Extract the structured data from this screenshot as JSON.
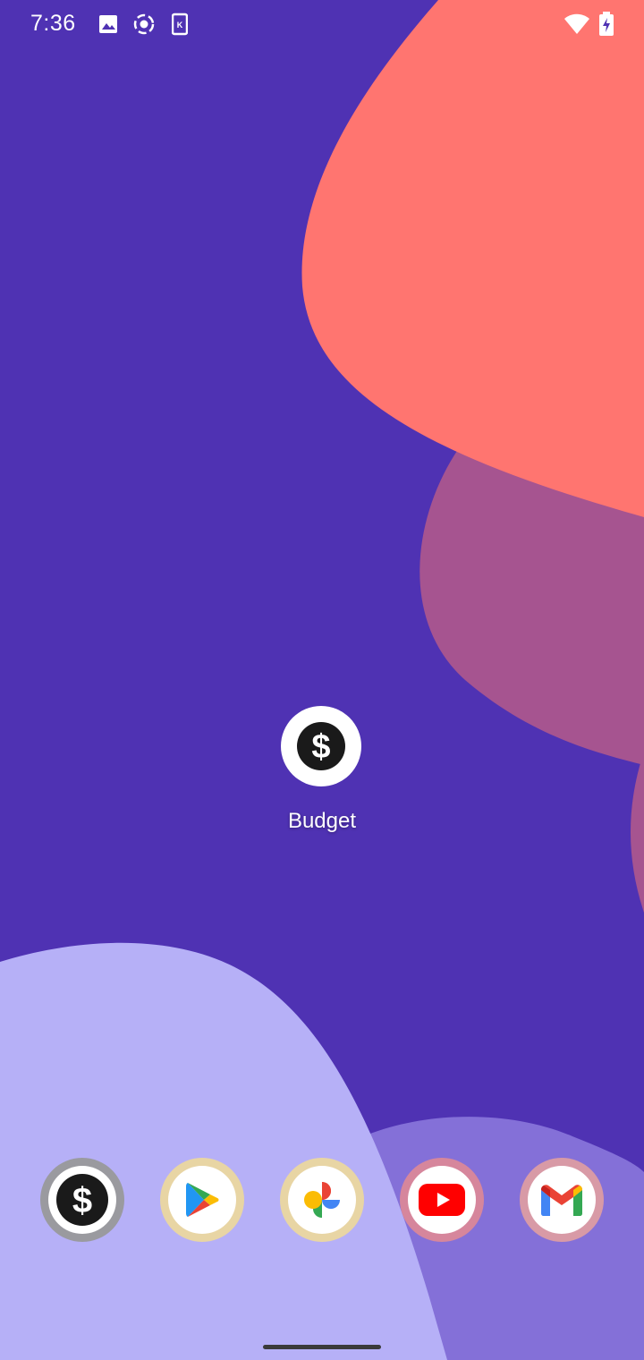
{
  "status_bar": {
    "time": "7:36",
    "left_icons": [
      "image-icon",
      "screen-record-icon",
      "k-app-icon"
    ],
    "right_icons": [
      "wifi-icon",
      "battery-charging-icon"
    ]
  },
  "home": {
    "app": {
      "label": "Budget",
      "icon": "dollar-icon"
    }
  },
  "dock": [
    {
      "app": "Budget",
      "icon": "dollar-icon",
      "ring_color": "#9a9a9f"
    },
    {
      "app": "Play Store",
      "icon": "play-store-icon",
      "ring_color": "#e8d5a4"
    },
    {
      "app": "Photos",
      "icon": "photos-pinwheel-icon",
      "ring_color": "#e8d5a4"
    },
    {
      "app": "YouTube",
      "icon": "youtube-icon",
      "ring_color": "#d6869c"
    },
    {
      "app": "Gmail",
      "icon": "gmail-icon",
      "ring_color": "#d89aa6"
    }
  ],
  "colors": {
    "wallpaper_base": "#4f32b3",
    "coral_blob": "#ff7570",
    "mauve_blob": "#a65490",
    "lavender_blob": "#b6b0f7",
    "violet_blob": "#8470d8"
  }
}
